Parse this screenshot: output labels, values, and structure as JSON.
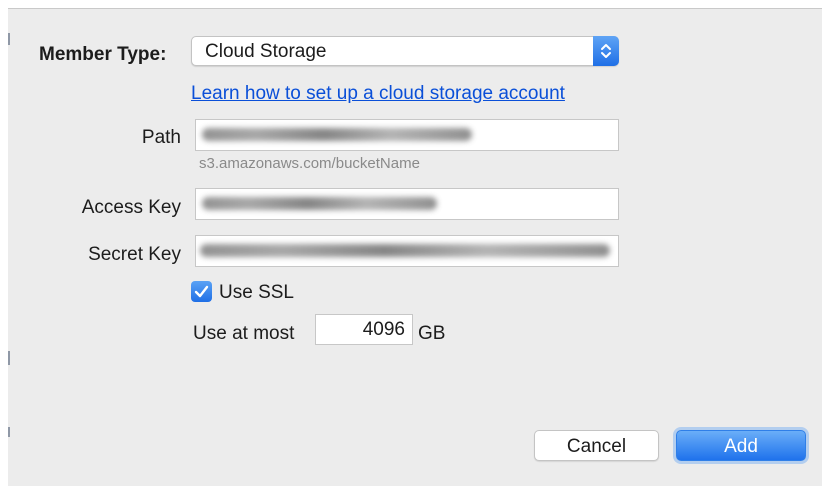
{
  "form": {
    "member_type": {
      "label": "Member Type:",
      "selected": "Cloud Storage",
      "icon": "chevron-up-down-icon"
    },
    "help_link": "Learn how to set up a cloud storage account",
    "path": {
      "label": "Path",
      "hint": "s3.amazonaws.com/bucketName"
    },
    "access_key": {
      "label": "Access Key"
    },
    "secret_key": {
      "label": "Secret Key"
    },
    "use_ssl": {
      "label": "Use SSL",
      "checked": true
    },
    "quota": {
      "prefix": "Use at most",
      "value": "4096",
      "unit": "GB"
    }
  },
  "buttons": {
    "cancel": "Cancel",
    "add": "Add"
  },
  "colors": {
    "accent": "#1f6fe6",
    "link": "#0a4fd8",
    "background": "#ececec"
  }
}
